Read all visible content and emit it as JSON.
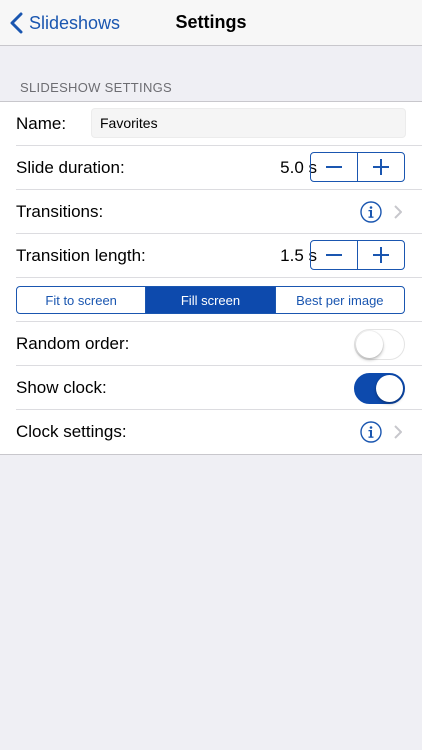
{
  "nav": {
    "back_label": "Slideshows",
    "title": "Settings"
  },
  "section": {
    "header": "SLIDESHOW SETTINGS"
  },
  "rows": {
    "name": {
      "label": "Name:",
      "value": "Favorites"
    },
    "slide_duration": {
      "label": "Slide duration:",
      "value": "5.0 s",
      "minus": "−",
      "plus": "+"
    },
    "transitions": {
      "label": "Transitions:"
    },
    "transition_length": {
      "label": "Transition length:",
      "value": "1.5 s"
    },
    "fill_mode": {
      "options": [
        "Fit to screen",
        "Fill screen",
        "Best per image"
      ],
      "selected": "Fill screen"
    },
    "random_order": {
      "label": "Random order:",
      "on": false
    },
    "show_clock": {
      "label": "Show clock:",
      "on": true
    },
    "clock_settings": {
      "label": "Clock settings:"
    }
  },
  "colors": {
    "accent": "#1a56b0",
    "active_segment": "#0d4aad",
    "background": "#efeff4"
  },
  "icons": {
    "back": "chevron-left-icon",
    "info": "info-icon",
    "disclosure": "chevron-right-icon"
  }
}
